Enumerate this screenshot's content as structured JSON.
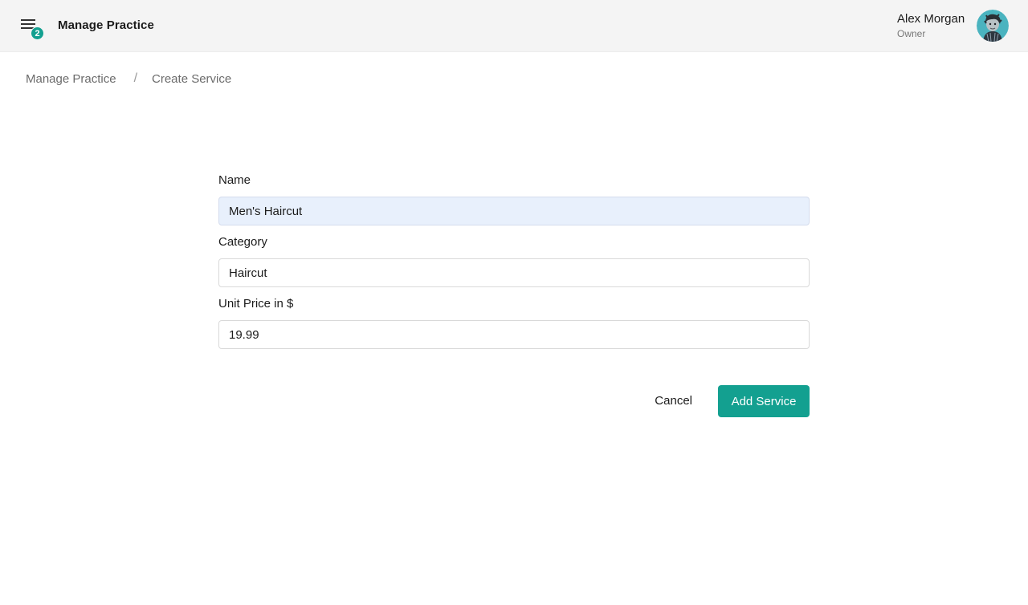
{
  "header": {
    "menu_badge": "2",
    "title": "Manage Practice",
    "user_name": "Alex Morgan",
    "user_role": "Owner"
  },
  "breadcrumb": {
    "items": [
      "Manage Practice",
      "Create Service"
    ],
    "separator": "/"
  },
  "form": {
    "name": {
      "label": "Name",
      "value": "Men's Haircut"
    },
    "category": {
      "label": "Category",
      "value": "Haircut"
    },
    "price": {
      "label": "Unit Price in $",
      "value": "19.99"
    },
    "cancel_label": "Cancel",
    "submit_label": "Add Service"
  },
  "colors": {
    "accent": "#13a090",
    "autofill_bg": "#e8f0fc",
    "topbar_bg": "#f4f4f4"
  },
  "icons": {
    "menu": "menu-icon",
    "avatar": "avatar-image"
  }
}
